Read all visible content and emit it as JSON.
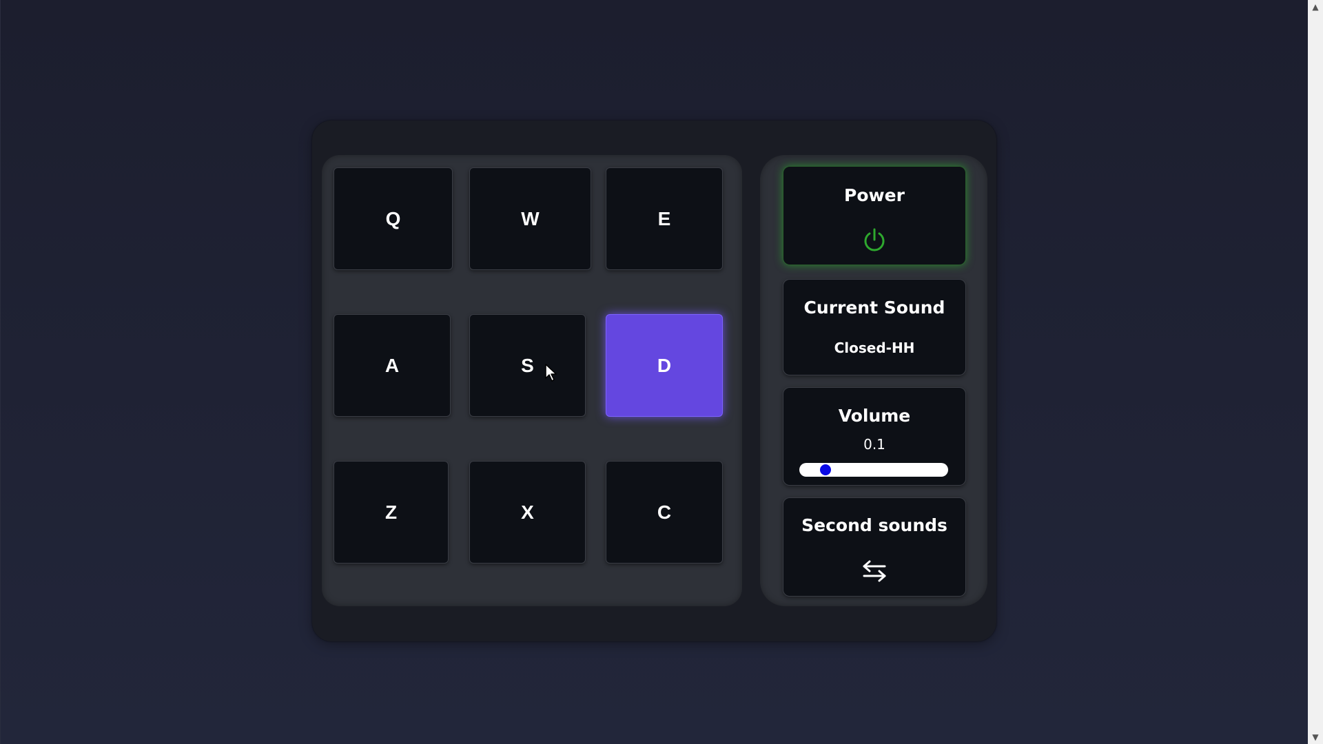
{
  "pads": [
    {
      "key": "Q",
      "active": false
    },
    {
      "key": "W",
      "active": false
    },
    {
      "key": "E",
      "active": false
    },
    {
      "key": "A",
      "active": false
    },
    {
      "key": "S",
      "active": false
    },
    {
      "key": "D",
      "active": true
    },
    {
      "key": "Z",
      "active": false
    },
    {
      "key": "X",
      "active": false
    },
    {
      "key": "C",
      "active": false
    }
  ],
  "controls": {
    "power": {
      "label": "Power",
      "icon": "power-icon",
      "state": "on",
      "color": "#2ea82e"
    },
    "current_sound": {
      "label": "Current Sound",
      "value": "Closed-HH"
    },
    "volume": {
      "label": "Volume",
      "value": "0.1",
      "level": 0.1
    },
    "second_sounds": {
      "label": "Second sounds",
      "icon": "swap-arrows-icon"
    }
  },
  "colors": {
    "active_pad": "#6447e0",
    "slider_thumb": "#0a0ae6",
    "power_glow": "#28c828"
  }
}
